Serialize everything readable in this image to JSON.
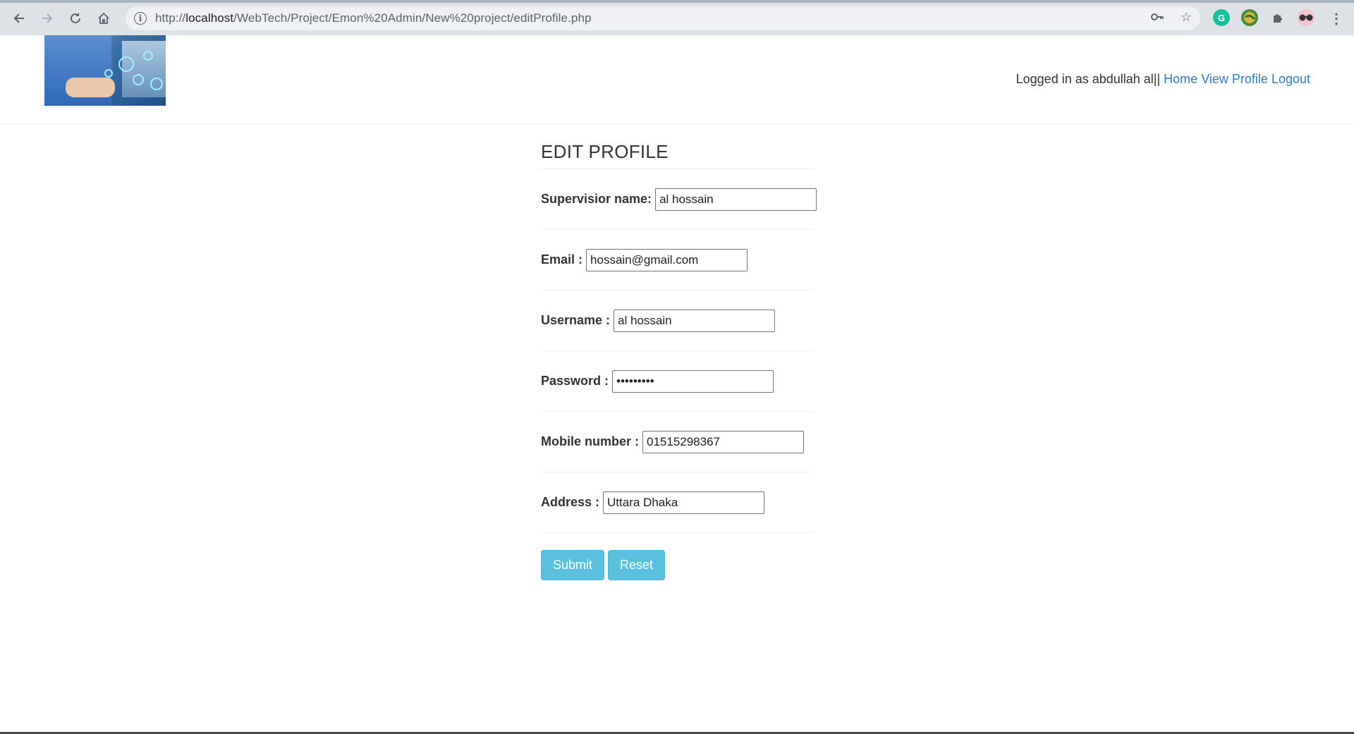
{
  "browser": {
    "url_prefix": "http://",
    "url_host": "localhost",
    "url_path": "/WebTech/Project/Emon%20Admin/New%20project/editProfile.php",
    "icons": [
      "back-icon",
      "forward-icon",
      "reload-icon",
      "home-icon",
      "site-info-icon",
      "key-icon",
      "bookmark-star-icon",
      "grammarly-icon",
      "extension-globe-icon",
      "extensions-puzzle-icon",
      "profile-avatar-icon",
      "menu-kebab-icon"
    ]
  },
  "header": {
    "logged_in_text": "Logged in as abdullah al||",
    "links": {
      "home": "Home",
      "view_profile": "View Profile",
      "logout": "Logout"
    }
  },
  "form": {
    "title": "EDIT PROFILE",
    "fields": {
      "supervisor_name": {
        "label": "Supervisior name:",
        "value": "al hossain"
      },
      "email": {
        "label": "Email :",
        "value": "hossain@gmail.com"
      },
      "username": {
        "label": "Username :",
        "value": "al hossain"
      },
      "password": {
        "label": "Password :",
        "value": "•••••••••"
      },
      "mobile": {
        "label": "Mobile number :",
        "value": "01515298367"
      },
      "address": {
        "label": "Address :",
        "value": "Uttara Dhaka"
      }
    },
    "submit_label": "Submit",
    "reset_label": "Reset",
    "button_color": "#5bc0de",
    "link_color": "#337ab7"
  }
}
